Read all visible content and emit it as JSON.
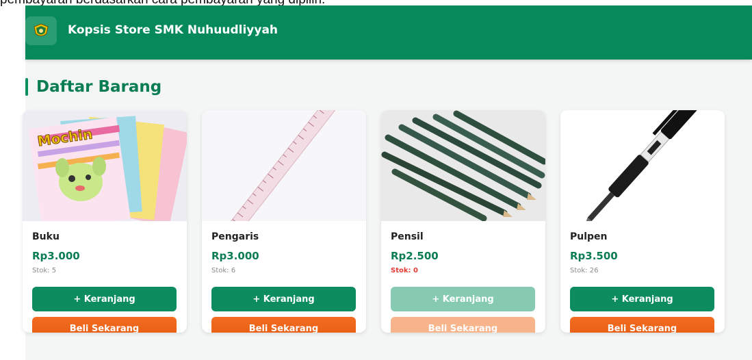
{
  "caption": "pembayaran berdasarkan cara pembayaran yang dipilih.",
  "header": {
    "store_name": "Kopsis Store SMK Nuhuudliyyah",
    "brand_color": "#068a5c"
  },
  "section": {
    "title": "Daftar Barang"
  },
  "products": [
    {
      "name": "Buku",
      "price": "Rp3.000",
      "stock": "Stok: 5",
      "cart_label": "+ Keranjang",
      "buy_label": "Beli Sekarang",
      "available": true
    },
    {
      "name": "Pengaris",
      "price": "Rp3.000",
      "stock": "Stok: 6",
      "cart_label": "+ Keranjang",
      "buy_label": "Beli Sekarang",
      "available": true
    },
    {
      "name": "Pensil",
      "price": "Rp2.500",
      "stock": "Stok: 0",
      "cart_label": "+ Keranjang",
      "buy_label": "Beli Sekarang",
      "available": false
    },
    {
      "name": "Pulpen",
      "price": "Rp3.500",
      "stock": "Stok: 26",
      "cart_label": "+ Keranjang",
      "buy_label": "Beli Sekarang",
      "available": true
    }
  ],
  "colors": {
    "accent_green": "#0b7d52",
    "button_orange": "#f26d21",
    "out_of_stock": "#e53935"
  }
}
